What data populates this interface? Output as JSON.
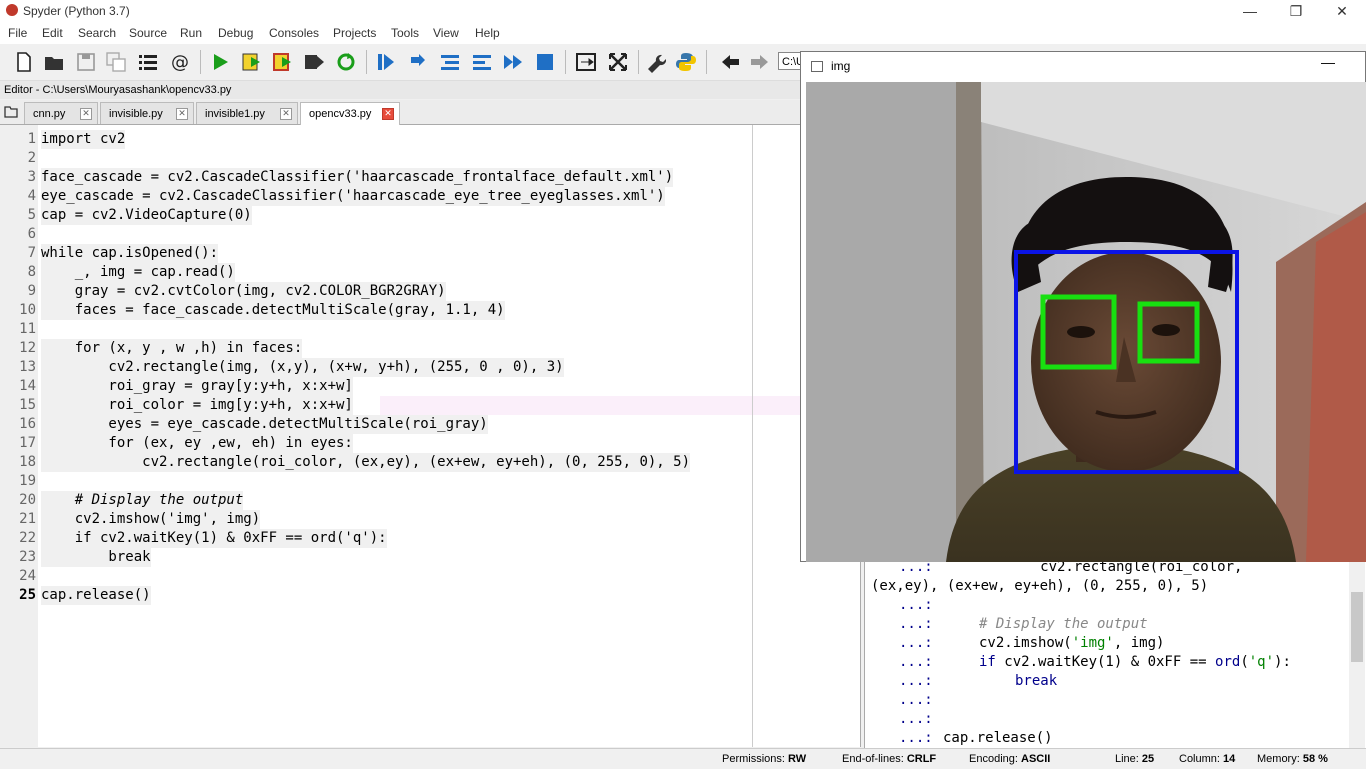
{
  "window": {
    "title": "Spyder (Python 3.7)",
    "minimize": "—",
    "restore": "❐",
    "close": "✕"
  },
  "menu": [
    "File",
    "Edit",
    "Search",
    "Source",
    "Run",
    "Debug",
    "Consoles",
    "Projects",
    "Tools",
    "View",
    "Help"
  ],
  "toolbar": {
    "path_value": "C:\\U"
  },
  "editor": {
    "header": "Editor - C:\\Users\\Mouryasashank\\opencv33.py",
    "tabs": [
      {
        "label": "cnn.py",
        "close": "✕"
      },
      {
        "label": "invisible.py",
        "close": "✕"
      },
      {
        "label": "invisible1.py",
        "close": "✕"
      },
      {
        "label": "opencv33.py",
        "close": "✕"
      }
    ],
    "line_numbers": [
      "1",
      "2",
      "3",
      "4",
      "5",
      "6",
      "7",
      "8",
      "9",
      "10",
      "11",
      "12",
      "13",
      "14",
      "15",
      "16",
      "17",
      "18",
      "19",
      "20",
      "21",
      "22",
      "23",
      "24",
      "25"
    ],
    "lines": [
      "import cv2",
      "",
      "face_cascade = cv2.CascadeClassifier('haarcascade_frontalface_default.xml')",
      "eye_cascade = cv2.CascadeClassifier('haarcascade_eye_tree_eyeglasses.xml')",
      "cap = cv2.VideoCapture(0)",
      "",
      "while cap.isOpened():",
      "    _, img = cap.read()",
      "    gray = cv2.cvtColor(img, cv2.COLOR_BGR2GRAY)",
      "    faces = face_cascade.detectMultiScale(gray, 1.1, 4)",
      "",
      "    for (x, y , w ,h) in faces:",
      "        cv2.rectangle(img, (x,y), (x+w, y+h), (255, 0 , 0), 3)",
      "        roi_gray = gray[y:y+h, x:x+w]",
      "        roi_color = img[y:y+h, x:x+w]",
      "        eyes = eye_cascade.detectMultiScale(roi_gray)",
      "        for (ex, ey ,ew, eh) in eyes:",
      "            cv2.rectangle(roi_color, (ex,ey), (ex+ew, ey+eh), (0, 255, 0), 5)",
      "",
      "    # Display the output",
      "    cv2.imshow('img', img)",
      "    if cv2.waitKey(1) & 0xFF == ord('q'):",
      "        break",
      "",
      "cap.release()"
    ],
    "current_line": 25
  },
  "console": {
    "prompt": "...:",
    "l1": "            cv2.rectangle(roi_color,",
    "l2": "(ex,ey), (ex+ew, ey+eh), (0, 255, 0), 5)",
    "comment": "# Display the output",
    "imshow_a": "cv2.imshow(",
    "imshow_s": "'img'",
    "imshow_b": ", img)",
    "if_kw": "if",
    "if_a": " cv2.waitKey(1) & 0xFF == ",
    "if_ord": "ord",
    "if_b": "(",
    "if_s": "'q'",
    "if_c": "):",
    "brk": "break",
    "release": "cap.release()"
  },
  "image_window": {
    "title": "img",
    "minimize": "—"
  },
  "status": {
    "perm_label": "Permissions:",
    "perm_value": "RW",
    "eol_label": "End-of-lines:",
    "eol_value": "CRLF",
    "enc_label": "Encoding:",
    "enc_value": "ASCII",
    "line_label": "Line:",
    "line_value": "25",
    "col_label": "Column:",
    "col_value": "14",
    "mem_label": "Memory:",
    "mem_value": "58 %"
  },
  "colors": {
    "face_box": "#0b14e6",
    "eye_box": "#18e010",
    "accent": "#e74c3c"
  },
  "icons": [
    "new-file-icon",
    "open-folder-icon",
    "save-icon",
    "save-all-icon",
    "list-icon",
    "at-icon",
    "run-icon",
    "run-cell-icon",
    "run-cell-advance-icon",
    "run-selection-icon",
    "rerun-icon",
    "debug-icon",
    "step-icon",
    "step-into-icon",
    "step-return-icon",
    "continue-icon",
    "stop-icon",
    "maximize-pane-icon",
    "fullscreen-icon",
    "wrench-icon",
    "python-icon",
    "back-arrow-icon",
    "forward-arrow-icon"
  ]
}
